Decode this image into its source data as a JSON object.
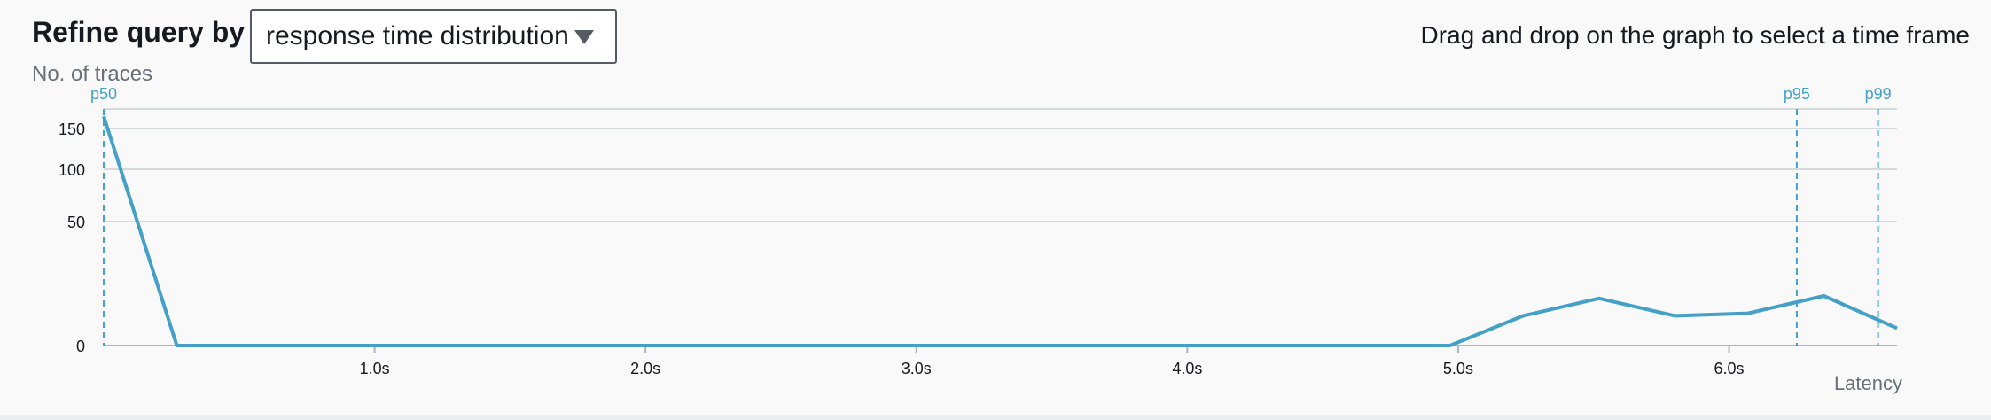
{
  "header": {
    "title": "Refine query by",
    "dropdown_value": "response time distribution",
    "hint": "Drag and drop on the graph to select a time frame"
  },
  "colors": {
    "series": "#44a0c6",
    "grid": "#d5dbdb",
    "axis_text": "#16191f",
    "muted_text": "#687078"
  },
  "icons": {
    "dropdown": "caret-down-icon"
  },
  "chart_data": {
    "type": "line",
    "title": "",
    "ylabel": "No. of traces",
    "xlabel": "Latency",
    "y_ticks": [
      0,
      50,
      100,
      150
    ],
    "x_ticks": [
      "1.0s",
      "2.0s",
      "3.0s",
      "4.0s",
      "5.0s",
      "6.0s"
    ],
    "xlim": [
      0.0,
      6.62
    ],
    "series": [
      {
        "x": [
          0.0,
          0.27,
          4.97,
          5.24,
          5.52,
          5.8,
          6.07,
          6.35,
          6.62
        ],
        "y": [
          165,
          0,
          0,
          12,
          19,
          12,
          13,
          20,
          7
        ]
      }
    ],
    "markers": [
      {
        "label": "p50",
        "x": 0.0
      },
      {
        "label": "p95",
        "x": 6.25
      },
      {
        "label": "p99",
        "x": 6.55
      }
    ],
    "grid": true
  }
}
